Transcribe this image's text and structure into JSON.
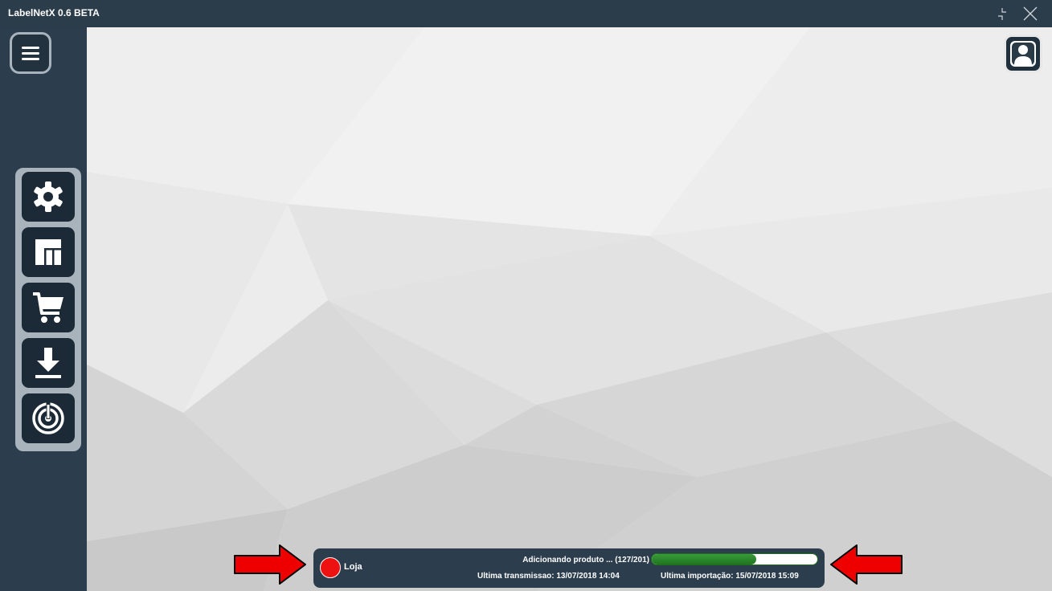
{
  "window": {
    "title": "LabelNetX 0.6 BETA"
  },
  "sidebar": {
    "menu_icon": "hamburger-icon",
    "tools": [
      {
        "name": "settings",
        "icon": "gear-icon"
      },
      {
        "name": "dashboard",
        "icon": "layout-icon"
      },
      {
        "name": "cart",
        "icon": "cart-icon"
      },
      {
        "name": "download",
        "icon": "download-icon"
      },
      {
        "name": "sync",
        "icon": "sync-icon"
      }
    ]
  },
  "header": {
    "user_icon": "user-icon"
  },
  "status": {
    "store_label": "Loja",
    "store_status_color": "#ee1111",
    "progress_text": "Adicionando produto ... (127/201)",
    "progress_value": 0.632,
    "last_transmission": "Ultima transmissao: 13/07/2018 14:04",
    "last_import": "Ultima importação: 15/07/2018 15:09"
  },
  "annotations": {
    "arrow_color": "#ee0000"
  }
}
